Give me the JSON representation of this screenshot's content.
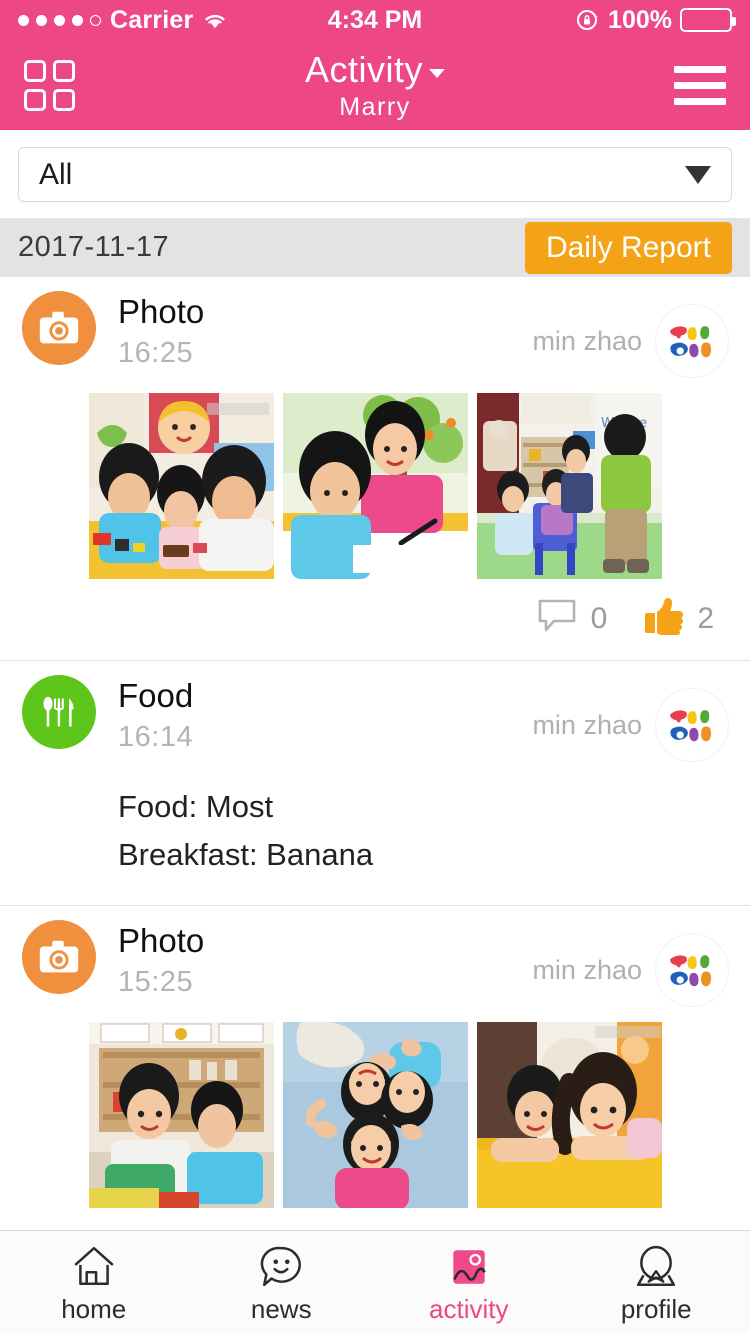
{
  "status_bar": {
    "signal_dots_filled": 4,
    "signal_dots_total": 5,
    "carrier": "Carrier",
    "wifi_icon": "wifi-icon",
    "time": "4:34 PM",
    "rotation_lock_icon": "rotation-lock-icon",
    "battery_percent": "100%",
    "battery_icon": "battery-full-icon"
  },
  "nav": {
    "grid_icon": "grid-menu-icon",
    "title": "Activity",
    "chevron_icon": "chevron-down-icon",
    "subtitle": "Marry",
    "hamburger_icon": "hamburger-menu-icon"
  },
  "filter": {
    "selected": "All",
    "caret_icon": "caret-down-icon",
    "options": [
      "All"
    ]
  },
  "date_bar": {
    "date": "2017-11-17",
    "daily_report_label": "Daily Report"
  },
  "colors": {
    "brand_pink": "#ed4785",
    "photo_orange": "#f0903f",
    "food_green": "#5ec51b",
    "report_orange": "#f5a316",
    "like_orange": "#f5a316",
    "date_bar_gray": "#e3e3e3",
    "muted_text": "#b4b4b4"
  },
  "entries": [
    {
      "type": "Photo",
      "icon": "camera-icon",
      "icon_color": "#f0903f",
      "time": "16:25",
      "author": "min zhao",
      "avatar_icon": "colorful-petals-avatar",
      "photos": [
        "kids-playing-with-clay-at-yellow-table",
        "boy-and-girl-in-pink-drawing-on-paper",
        "children-in-classroom-with-blue-chairs"
      ],
      "comment_count": "0",
      "like_count": "2",
      "comment_icon": "comment-bubble-icon",
      "like_icon": "thumbs-up-icon"
    },
    {
      "type": "Food",
      "icon": "cutlery-icon",
      "icon_color": "#5ec51b",
      "time": "16:14",
      "author": "min zhao",
      "avatar_icon": "colorful-petals-avatar",
      "lines": [
        "Food: Most",
        "Breakfast: Banana"
      ]
    },
    {
      "type": "Photo",
      "icon": "camera-icon",
      "icon_color": "#f0903f",
      "time": "15:25",
      "author": "min zhao",
      "avatar_icon": "colorful-petals-avatar",
      "photos": [
        "two-boys-lying-on-floor-with-blocks",
        "three-children-lying-down-in-circle",
        "boy-and-girl-resting-on-yellow-mat"
      ]
    }
  ],
  "tabbar": {
    "items": [
      {
        "label": "home",
        "icon": "home-icon",
        "active": false
      },
      {
        "label": "news",
        "icon": "chat-smiley-icon",
        "active": false
      },
      {
        "label": "activity",
        "icon": "image-icon",
        "active": true
      },
      {
        "label": "profile",
        "icon": "person-icon",
        "active": false
      }
    ]
  }
}
